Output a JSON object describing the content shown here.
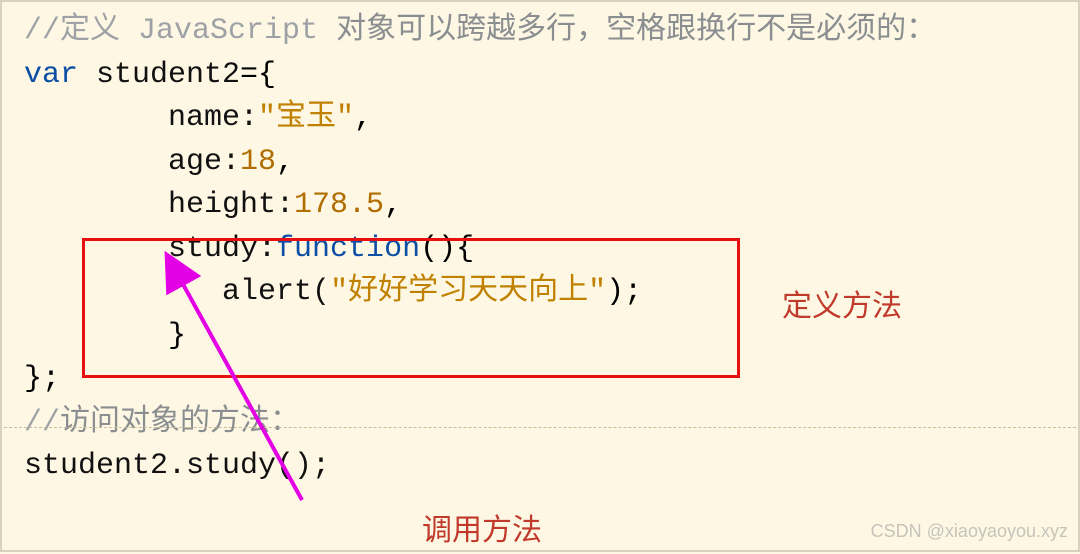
{
  "code": {
    "line1_a": "//",
    "line1_b": "定义 JavaScript",
    "line1_c": " 对象可以跨越多行，空格跟换行不是必须的：",
    "kw_var": "var",
    "ident_student2": " student2",
    "eq_open": "={",
    "prop_name": "        name:",
    "val_name": "\"宝玉\"",
    "comma": ",",
    "prop_age": "        age:",
    "val_age": "18",
    "prop_height": "        height:",
    "val_height": "178.5",
    "prop_study": "        study:",
    "kw_function": "function",
    "fn_parens": "(){",
    "alert_indent": "           alert(",
    "val_alert": "\"好好学习天天向上\"",
    "alert_close": ");",
    "brace_close_inner": "        }",
    "brace_close_outer": "};",
    "line_access_a": "//",
    "line_access_b": "访问对象的方法：",
    "call": "student2.study();"
  },
  "labels": {
    "define": "定义方法",
    "call": "调用方法"
  },
  "watermark": "CSDN @xiaoyaoyou.xyz",
  "colors": {
    "comment": "#8a8e91",
    "keyword": "#0b4ea5",
    "string": "#c08000",
    "number": "#b06d00",
    "annotation": "#c0392b",
    "redbox": "#e61010",
    "arrow": "#e400e4",
    "bg": "#fdf7e3"
  }
}
